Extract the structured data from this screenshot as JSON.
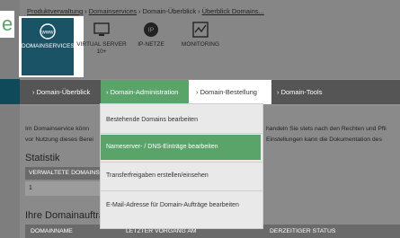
{
  "breadcrumb": [
    "Produktverwaltung",
    "Domainservices",
    "Domain-Überblick",
    "Überblick Domains..."
  ],
  "brand_letter": "e",
  "services": [
    {
      "label": "DOMAINSERVICES",
      "icon": "www-icon"
    },
    {
      "label": "VIRTUAL SERVER 10+",
      "icon": "monitor-icon"
    },
    {
      "label": "IP-NETZE",
      "icon": "ip-icon"
    },
    {
      "label": "MONITORING",
      "icon": "monitoring-icon"
    }
  ],
  "nav": [
    {
      "label": "Domain-Überblick"
    },
    {
      "label": "Domain-Administration"
    },
    {
      "label": "Domain-Bestellung"
    },
    {
      "label": "Domain-Tools"
    }
  ],
  "dropdown": [
    {
      "label": "Bestehende Domains bearbeiten"
    },
    {
      "label": "Nameserver- / DNS-Einträge bearbeiten"
    },
    {
      "label": "Transferfreigaben erstellen/einsehen"
    },
    {
      "label": "E-Mail-Adresse für Domain-Aufträge bearbeiten"
    }
  ],
  "intro": {
    "line1_left": "Im Domainservice könn",
    "line2_left": "vor Nutzung dieses Berei",
    "line1_right": "handeln Sie stets nach den Rechten und Pfli",
    "line2_right": "Einstellungen kann die Dokumentation des"
  },
  "statistik": {
    "title": "Statistik",
    "header": "VERWALTETE DOMAINS",
    "value": "1"
  },
  "orders": {
    "title": "Ihre Domainaufträ",
    "columns": [
      "DOMAINNAME",
      "LETZTER VORGANG AM",
      "DERZEITIGER STATUS"
    ]
  },
  "colors": {
    "accent_green": "#5aa469",
    "brand_teal": "#1b5366",
    "overlay_gray": "#8f8f8f"
  }
}
